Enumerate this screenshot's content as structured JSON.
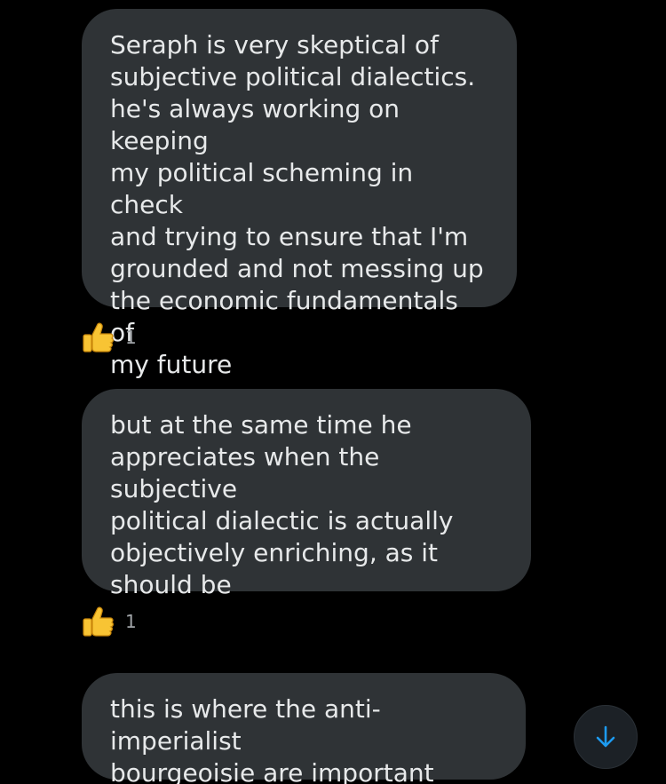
{
  "messages": [
    {
      "text": "Seraph is very skeptical of\nsubjective political dialectics.\nhe's always working on keeping\nmy political scheming in check\nand trying to ensure that I'm\ngrounded and not messing up\nthe economic fundamentals of\nmy future",
      "reaction": {
        "icon": "thumbs-up-icon",
        "count": "1"
      }
    },
    {
      "text": "but at the same time he\nappreciates when the subjective\npolitical dialectic is actually\nobjectively enriching, as it\nshould be",
      "reaction": {
        "icon": "thumbs-up-icon",
        "count": "1"
      }
    },
    {
      "text": "this is where the anti-imperialist\nbourgeoisie are important"
    }
  ],
  "scroll_button": {
    "icon": "arrow-down-icon"
  },
  "colors": {
    "background": "#000000",
    "bubble": "#2f3336",
    "text": "#e7e9ea",
    "accent": "#1d9bf0",
    "reaction_count": "#a0a4a8"
  }
}
